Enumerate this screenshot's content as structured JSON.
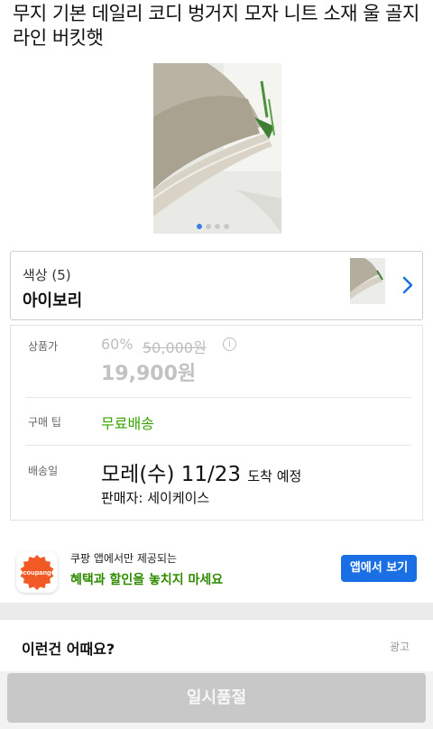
{
  "product": {
    "title": "무지 기본 데일리 코디 벙거지 모자 니트 소재 울 골지 라인 버킷햇",
    "image_count": 4,
    "active_image_index": 0
  },
  "color_option": {
    "label": "색상 (5)",
    "value": "아이보리"
  },
  "price_info": {
    "label": "상품가",
    "discount": "60%",
    "original_price": "50,000원",
    "sale_price": "19,900원",
    "info_glyph": "i"
  },
  "purchase_tip": {
    "label": "구매 팁",
    "value": "무료배송"
  },
  "delivery": {
    "label": "배송일",
    "date": "모레(수) 11/23",
    "suffix": "도착 예정",
    "seller": "판매자: 세이케이스"
  },
  "app_banner": {
    "logo_text": "coupang",
    "subtitle": "쿠팡 앱에서만 제공되는",
    "headline": "혜택과 할인을 놓치지 마세요",
    "button_label": "앱에서 보기"
  },
  "recommendation": {
    "title": "이런건 어때요?",
    "ad_label": "광고"
  },
  "bottom": {
    "button_label": "일시품절"
  },
  "colors": {
    "accent_blue": "#1a6fe4",
    "green": "#38a300",
    "coupang_orange": "#f15a24",
    "soldout_gray": "#c8c8c8"
  },
  "icons": [
    "info-icon",
    "chevron-right-icon",
    "coupang-logo-icon"
  ]
}
